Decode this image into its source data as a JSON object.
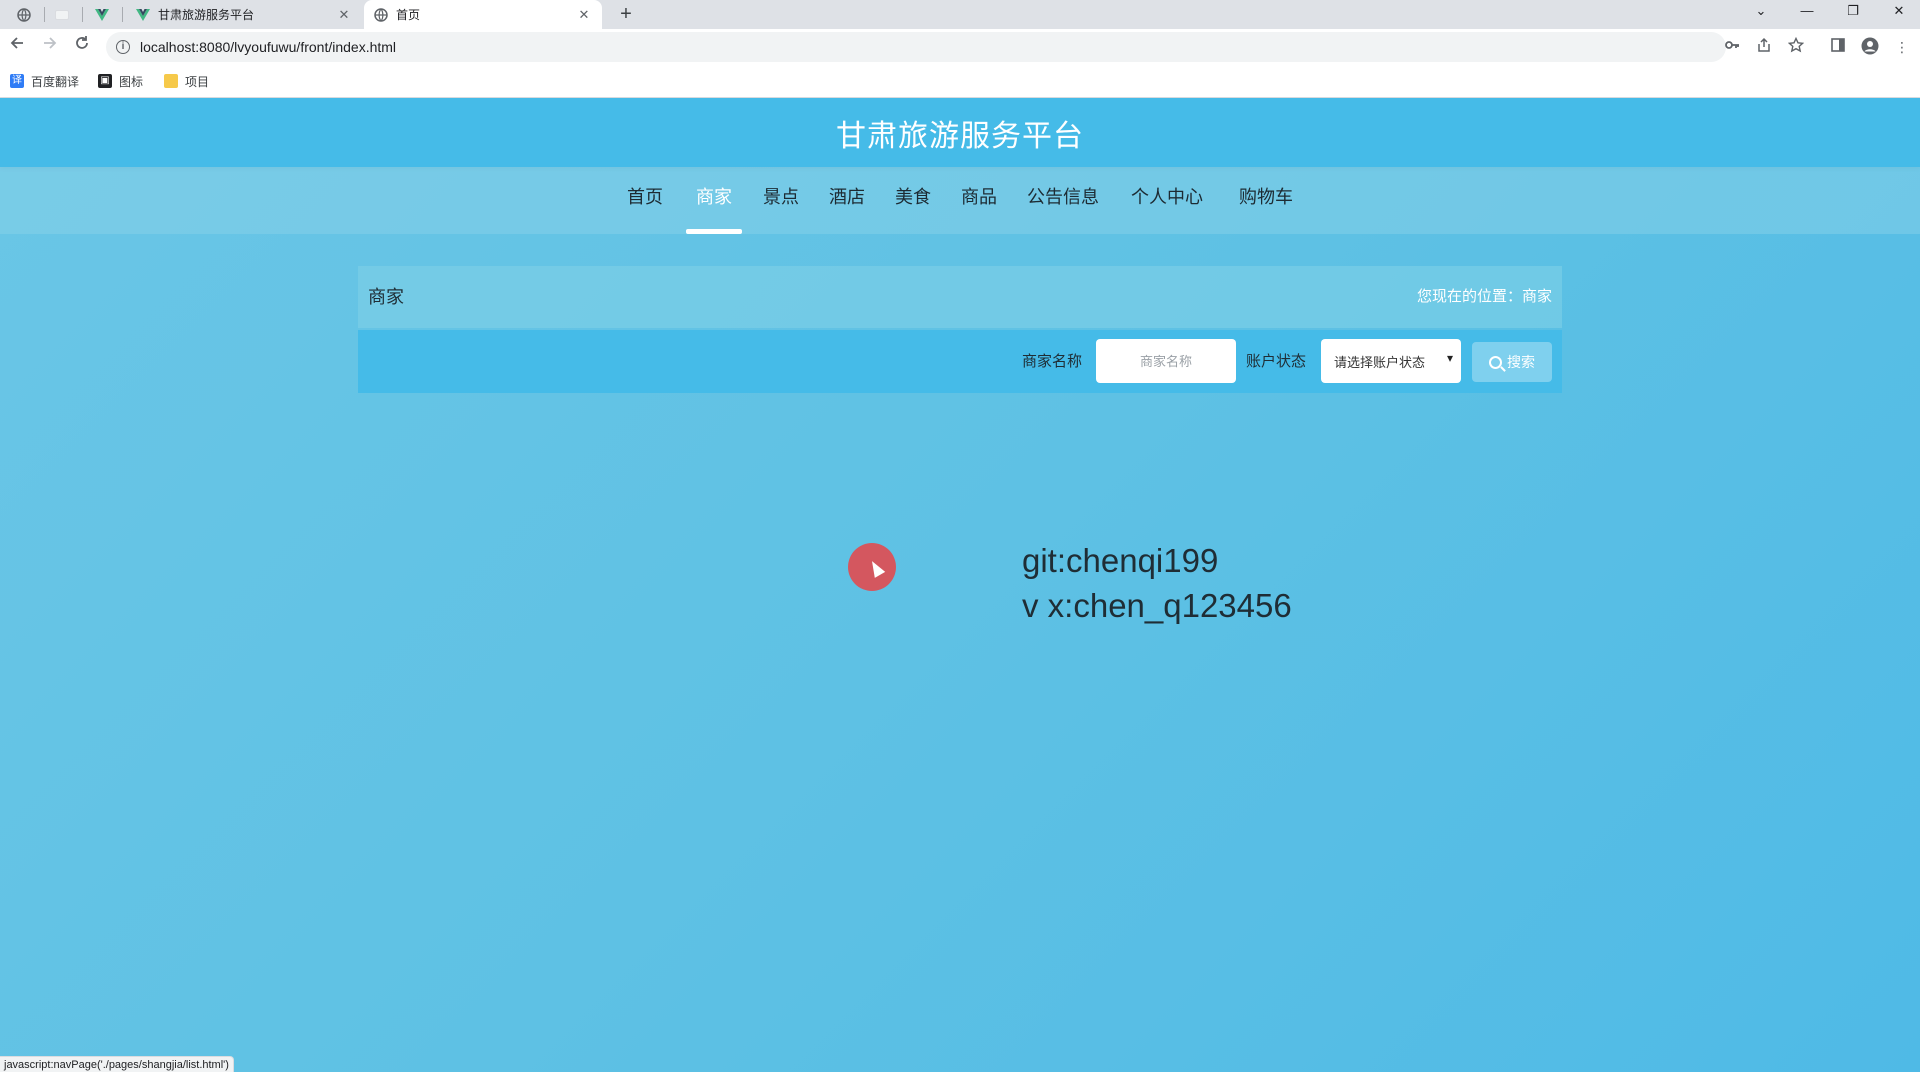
{
  "browser": {
    "tabs": [
      {
        "title": "甘肃旅游服务平台",
        "active": false
      },
      {
        "title": "首页",
        "active": true
      }
    ],
    "url": "localhost:8080/lvyoufuwu/front/index.html",
    "bookmarks": [
      {
        "label": "百度翻译",
        "icon": "translate-icon",
        "color": "#2f7cf6"
      },
      {
        "label": "图标",
        "icon": "image-icon",
        "color": "#202124"
      },
      {
        "label": "项目",
        "icon": "folder-icon",
        "color": "#f6c94a"
      }
    ],
    "status_text": "javascript:navPage('./pages/shangjia/list.html')"
  },
  "site": {
    "title": "甘肃旅游服务平台",
    "nav": [
      {
        "label": "首页",
        "active": false
      },
      {
        "label": "商家",
        "active": true
      },
      {
        "label": "景点",
        "active": false
      },
      {
        "label": "酒店",
        "active": false
      },
      {
        "label": "美食",
        "active": false
      },
      {
        "label": "商品",
        "active": false
      },
      {
        "label": "公告信息",
        "active": false
      },
      {
        "label": "个人中心",
        "active": false
      },
      {
        "label": "购物车",
        "active": false
      }
    ],
    "colors": {
      "header": "#45bbe8",
      "background": "#5dc0e3",
      "accent": "#ffffff"
    }
  },
  "breadcrumb": {
    "page": "商家",
    "location": "您现在的位置：商家"
  },
  "search": {
    "name_label": "商家名称",
    "name_placeholder": "商家名称",
    "status_label": "账户状态",
    "status_selected": "请选择账户状态",
    "button_label": "搜索"
  },
  "watermark": {
    "line1": "git:chenqi199",
    "line2": "v x:chen_q123456"
  }
}
